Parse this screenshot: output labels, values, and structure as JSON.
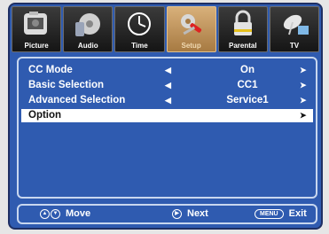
{
  "tabs": [
    {
      "label": "Picture",
      "icon": "picture-icon",
      "active": false
    },
    {
      "label": "Audio",
      "icon": "audio-icon",
      "active": false
    },
    {
      "label": "Time",
      "icon": "clock-icon",
      "active": false
    },
    {
      "label": "Setup",
      "icon": "setup-tools-icon",
      "active": true
    },
    {
      "label": "Parental",
      "icon": "lock-icon",
      "active": false
    },
    {
      "label": "TV",
      "icon": "satellite-dish-icon",
      "active": false
    }
  ],
  "menu": {
    "rows": [
      {
        "label": "CC Mode",
        "left_arrow": "◀",
        "value": "On",
        "right_arrow": "➤"
      },
      {
        "label": "Basic Selection",
        "left_arrow": "◀",
        "value": "CC1",
        "right_arrow": "➤"
      },
      {
        "label": "Advanced Selection",
        "left_arrow": "◀",
        "value": "Service1",
        "right_arrow": "➤"
      },
      {
        "label": "Option",
        "left_arrow": "",
        "value": "",
        "right_arrow": "➤",
        "selected": true
      }
    ]
  },
  "footer": {
    "move_label": "Move",
    "next_label": "Next",
    "menu_key": "MENU",
    "exit_label": "Exit"
  },
  "colors": {
    "background": "#2f5bb0",
    "highlight": "#ffffff",
    "active_tab": "#c89a5c"
  }
}
